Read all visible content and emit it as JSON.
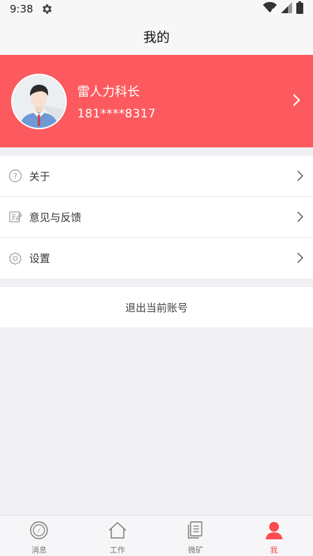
{
  "status_bar": {
    "time": "9:38"
  },
  "header": {
    "title": "我的"
  },
  "profile": {
    "name": "雷人力科长",
    "phone": "181****8317"
  },
  "menu": {
    "items": [
      {
        "label": "关于",
        "icon": "help-circle-icon"
      },
      {
        "label": "意见与反馈",
        "icon": "feedback-icon"
      },
      {
        "label": "设置",
        "icon": "settings-gear-icon"
      }
    ]
  },
  "logout": {
    "label": "退出当前账号"
  },
  "tabbar": {
    "tabs": [
      {
        "label": "消息",
        "icon": "compass-icon"
      },
      {
        "label": "工作",
        "icon": "home-icon"
      },
      {
        "label": "微矿",
        "icon": "document-icon"
      },
      {
        "label": "我",
        "icon": "user-icon",
        "active": true
      }
    ]
  },
  "colors": {
    "accent": "#fc5a5e",
    "tab_active": "#fc4a4e"
  }
}
